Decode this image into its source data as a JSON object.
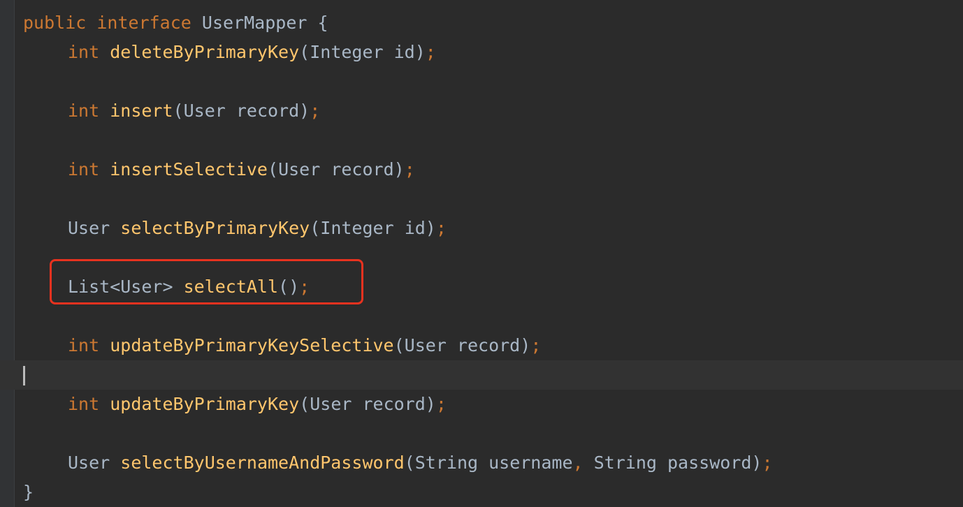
{
  "interface_decl": {
    "public_kw": "public",
    "interface_kw": "interface",
    "name": "UserMapper",
    "open_brace": "{"
  },
  "methods": [
    {
      "ret": "int",
      "name": "deleteByPrimaryKey",
      "open": "(",
      "params": "Integer id",
      "close": ")",
      "semi": ";"
    },
    {
      "ret": "int",
      "name": "insert",
      "open": "(",
      "params": "User record",
      "close": ")",
      "semi": ";"
    },
    {
      "ret": "int",
      "name": "insertSelective",
      "open": "(",
      "params": "User record",
      "close": ")",
      "semi": ";"
    },
    {
      "ret": "User",
      "name": "selectByPrimaryKey",
      "open": "(",
      "params": "Integer id",
      "close": ")",
      "semi": ";"
    },
    {
      "ret": "List<User>",
      "name": "selectAll",
      "open": "(",
      "params": "",
      "close": ")",
      "semi": ";"
    },
    {
      "ret": "int",
      "name": "updateByPrimaryKeySelective",
      "open": "(",
      "params": "User record",
      "close": ")",
      "semi": ";"
    },
    {
      "ret": "int",
      "name": "updateByPrimaryKey",
      "open": "(",
      "params": "User record",
      "close": ")",
      "semi": ";"
    },
    {
      "ret": "User",
      "name": "selectByUsernameAndPassword",
      "open": "(",
      "params_a": "String username",
      "comma": ",",
      "params_b": " String password",
      "close": ")",
      "semi": ";"
    }
  ],
  "close_brace": "}",
  "colors": {
    "background": "#2b2b2b",
    "keyword": "#cc7832",
    "method": "#ffc66d",
    "text": "#a9b7c6",
    "highlight_box": "#e8321f"
  }
}
